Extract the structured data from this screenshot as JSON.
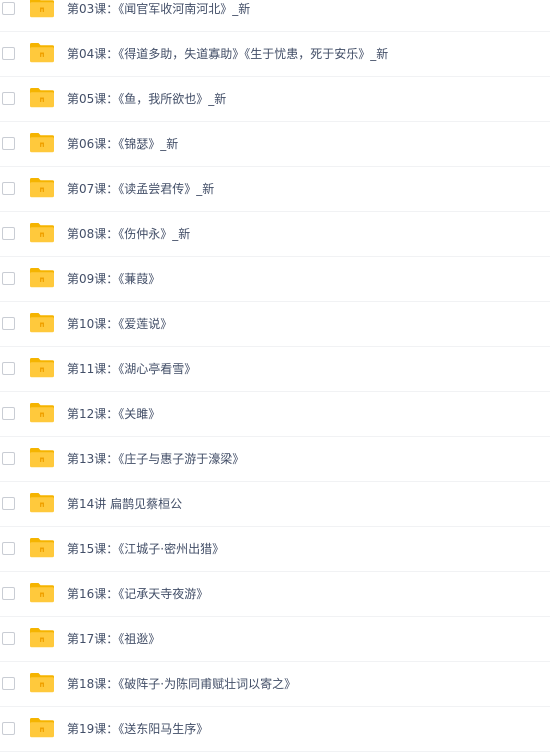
{
  "files": [
    {
      "name": "第03课：《闻官军收河南河北》_新",
      "icon": "folder-icon"
    },
    {
      "name": "第04课：《得道多助，失道寡助》《生于忧患，死于安乐》_新",
      "icon": "folder-icon"
    },
    {
      "name": "第05课：《鱼，我所欲也》_新",
      "icon": "folder-icon"
    },
    {
      "name": "第06课：《锦瑟》_新",
      "icon": "folder-icon"
    },
    {
      "name": "第07课：《读孟尝君传》_新",
      "icon": "folder-icon"
    },
    {
      "name": "第08课：《伤仲永》_新",
      "icon": "folder-icon"
    },
    {
      "name": "第09课：《蒹葭》",
      "icon": "folder-icon"
    },
    {
      "name": "第10课：《爱莲说》",
      "icon": "folder-icon"
    },
    {
      "name": "第11课：《湖心亭看雪》",
      "icon": "folder-icon"
    },
    {
      "name": "第12课：《关雎》",
      "icon": "folder-icon"
    },
    {
      "name": "第13课：《庄子与惠子游于濠梁》",
      "icon": "folder-icon"
    },
    {
      "name": "第14讲 扁鹊见蔡桓公",
      "icon": "folder-icon"
    },
    {
      "name": "第15课：《江城子·密州出猎》",
      "icon": "folder-icon"
    },
    {
      "name": "第16课：《记承天寺夜游》",
      "icon": "folder-icon"
    },
    {
      "name": "第17课：《祖逖》",
      "icon": "folder-icon"
    },
    {
      "name": "第18课：《破阵子·为陈同甫赋壮词以寄之》",
      "icon": "folder-icon"
    },
    {
      "name": "第19课：《送东阳马生序》",
      "icon": "folder-icon"
    }
  ],
  "colors": {
    "folder_body": "#ffc93c",
    "folder_tab": "#f5b400",
    "folder_mark": "#f0a100",
    "text": "#424e67",
    "row_border": "#f1f2f4",
    "checkbox_border": "#c9cdd4"
  }
}
